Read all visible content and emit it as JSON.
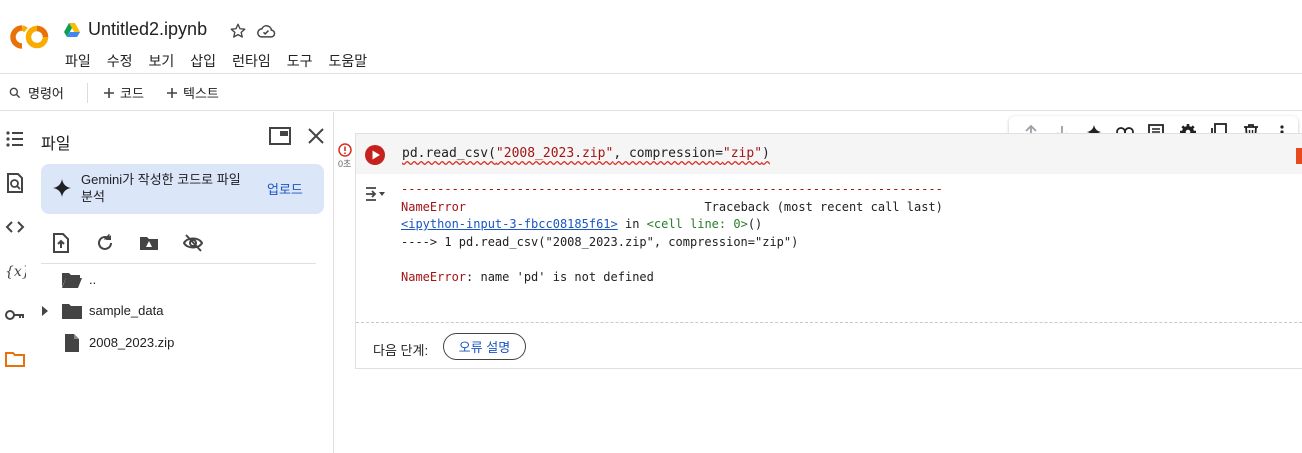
{
  "header": {
    "notebook_title": "Untitled2.ipynb",
    "menu": [
      "파일",
      "수정",
      "보기",
      "삽입",
      "런타임",
      "도구",
      "도움말"
    ]
  },
  "toolbar": {
    "commands_label": "명령어",
    "code_label": "코드",
    "text_label": "텍스트"
  },
  "files_panel": {
    "title": "파일",
    "gemini_text": "Gemini가 작성한 코드로 파일 분석",
    "upload_label": "업로드",
    "items": [
      {
        "name": "..",
        "type": "folder-open"
      },
      {
        "name": "sample_data",
        "type": "folder"
      },
      {
        "name": "2008_2023.zip",
        "type": "file"
      }
    ]
  },
  "cell": {
    "exec_time": "0초",
    "code_prefix": "pd.read_csv(",
    "code_arg1": "\"2008_2023.zip\"",
    "code_mid": ", compression=",
    "code_arg2": "\"zip\"",
    "code_suffix": ")",
    "output": {
      "dashes": "---------------------------------------------------------------------------",
      "error_name": "NameError",
      "traceback_label": "Traceback (most recent call last)",
      "input_link": "<ipython-input-3-fbcc08185f61>",
      "in_text": " in ",
      "cell_line": "<cell line: 0>",
      "cell_line_suffix": "()",
      "arrow_line": "----> 1 pd.read_csv(\"2008_2023.zip\", compression=\"zip\")",
      "final_error_name": "NameError",
      "final_error_msg": ": name 'pd' is not defined"
    },
    "next_steps_label": "다음 단계:",
    "explain_error_label": "오류 설명"
  },
  "colors": {
    "accent_blue": "#1a55c4",
    "error_red": "#d93025",
    "colab_orange": "#f9ab00",
    "card_bg": "#dbe6f8"
  }
}
